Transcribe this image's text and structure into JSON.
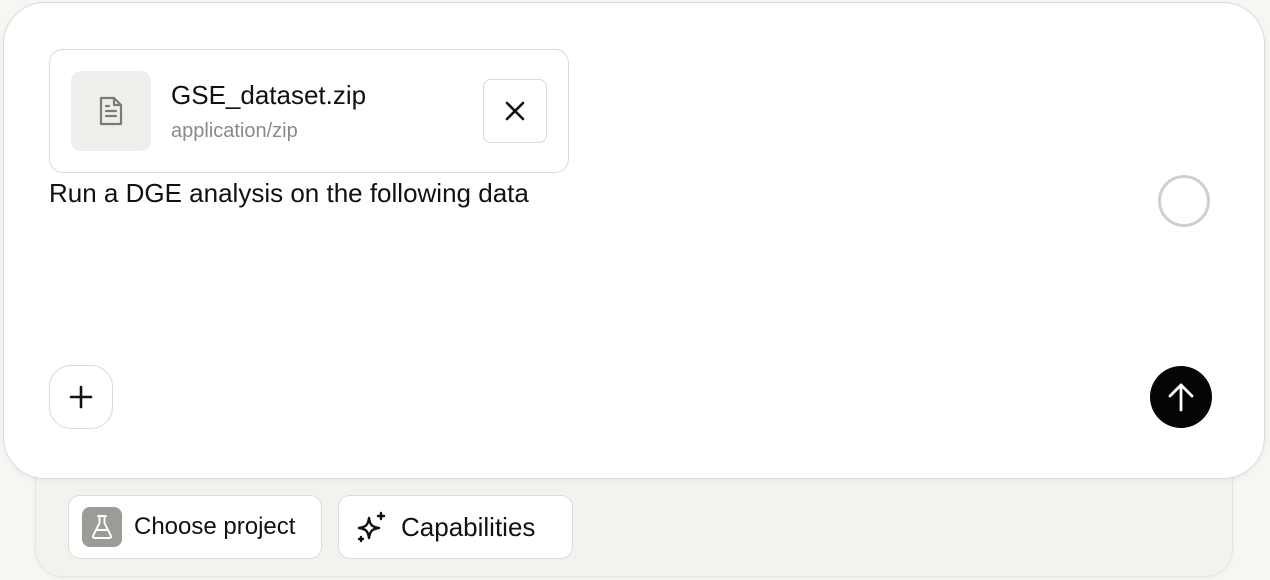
{
  "attachment": {
    "name": "GSE_dataset.zip",
    "type": "application/zip",
    "icon": "file-text-icon",
    "remove_icon": "close-icon"
  },
  "prompt": {
    "text": "Run a DGE analysis on the following data"
  },
  "status": {
    "icon": "progress-ring-icon"
  },
  "actions": {
    "add_icon": "plus-icon",
    "send_icon": "arrow-up-icon"
  },
  "toolbar": {
    "project_label": "Choose project",
    "project_icon": "flask-icon",
    "capabilities_label": "Capabilities",
    "capabilities_icon": "sparkles-icon"
  },
  "colors": {
    "send_button": "#050505",
    "attachment_icon_bg": "#efeeea",
    "flask_bg": "#9c9b97",
    "muted_text": "#8a8a8a"
  }
}
